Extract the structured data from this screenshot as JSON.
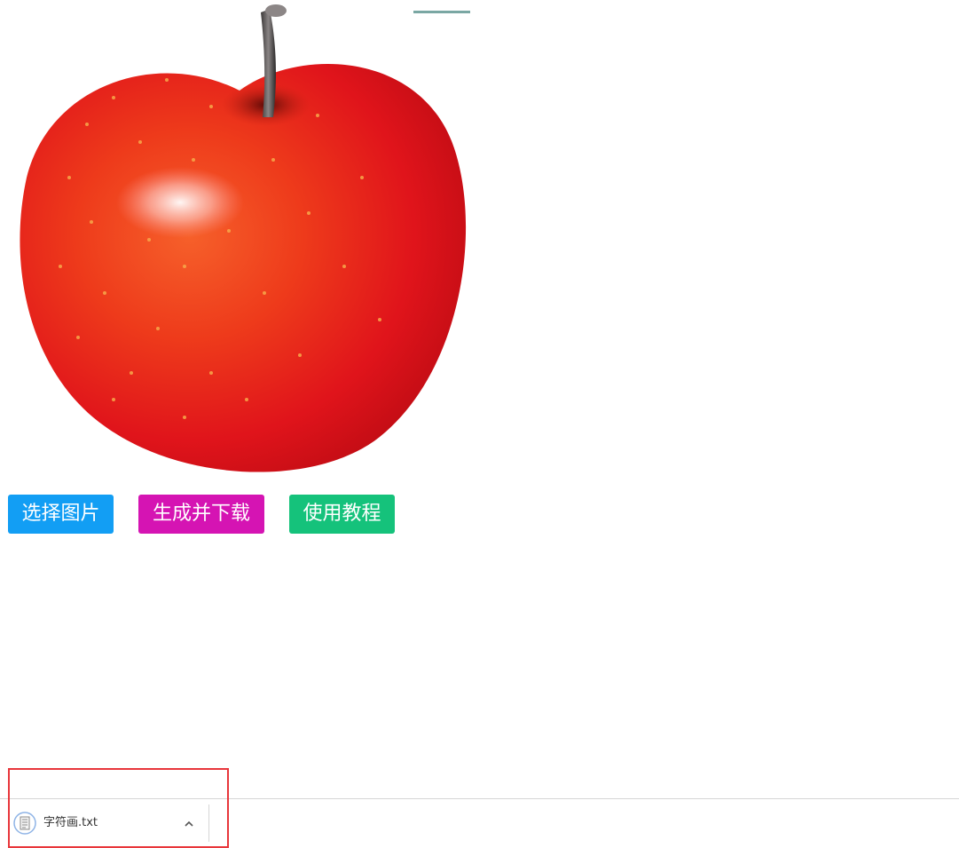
{
  "image": {
    "subject": "red-apple-photo"
  },
  "buttons": {
    "select_image": "选择图片",
    "generate_download": "生成并下载",
    "tutorial": "使用教程"
  },
  "colors": {
    "select_button": "#129ef4",
    "generate_button": "#d514b3",
    "tutorial_button": "#15c27b",
    "highlight": "#e8363b"
  },
  "download_bar": {
    "file_name": "字符画.txt",
    "file_icon": "text-file-icon",
    "expand_icon": "chevron-up-icon"
  }
}
